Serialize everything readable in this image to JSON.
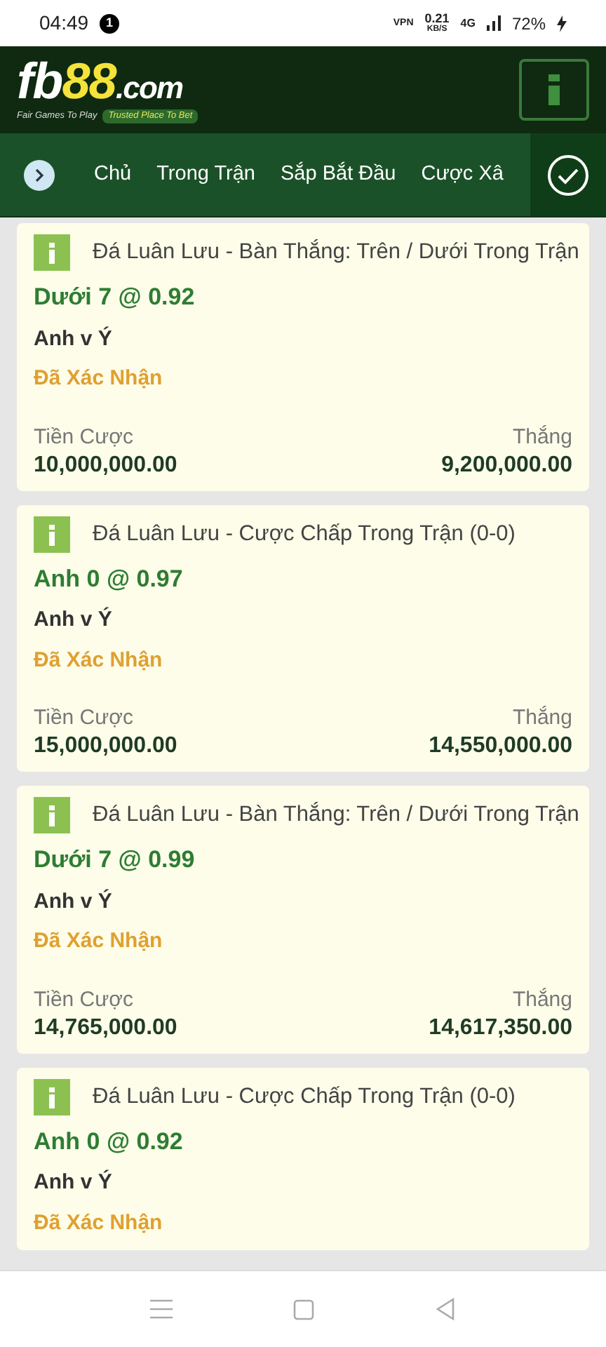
{
  "status_bar": {
    "time": "04:49",
    "notification_count": "1",
    "vpn": "VPN",
    "speed": "0.21",
    "speed_unit": "KB/S",
    "network": "4G",
    "battery": "72%"
  },
  "header": {
    "logo": {
      "part_1": "fb",
      "part_2": "88",
      "part_3": ".com",
      "tagline_1": "Fair Games To Play",
      "tagline_2": "Trusted Place To Bet"
    }
  },
  "nav": {
    "items": [
      "Chủ",
      "Trong Trận",
      "Sắp Bắt Đầu",
      "Cược Xâ"
    ]
  },
  "bets": [
    {
      "market": "Đá Luân Lưu - Bàn Thắng: Trên / Dưới Trong Trận",
      "selection": "Dưới 7 @ 0.92",
      "match": "Anh v Ý",
      "status": "Đã Xác Nhận",
      "stake_label": "Tiền Cược",
      "stake": "10,000,000.00",
      "win_label": "Thắng",
      "win": "9,200,000.00"
    },
    {
      "market": "Đá Luân Lưu - Cược Chấp Trong Trận (0-0)",
      "selection": "Anh 0 @ 0.97",
      "match": "Anh v Ý",
      "status": "Đã Xác Nhận",
      "stake_label": "Tiền Cược",
      "stake": "15,000,000.00",
      "win_label": "Thắng",
      "win": "14,550,000.00"
    },
    {
      "market": "Đá Luân Lưu - Bàn Thắng: Trên / Dưới Trong Trận",
      "selection": "Dưới 7 @ 0.99",
      "match": "Anh v Ý",
      "status": "Đã Xác Nhận",
      "stake_label": "Tiền Cược",
      "stake": "14,765,000.00",
      "win_label": "Thắng",
      "win": "14,617,350.00"
    },
    {
      "market": "Đá Luân Lưu - Cược Chấp Trong Trận (0-0)",
      "selection": "Anh 0 @ 0.92",
      "match": "Anh v Ý",
      "status": "Đã Xác Nhận"
    }
  ]
}
